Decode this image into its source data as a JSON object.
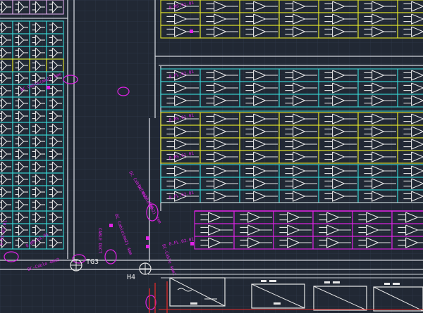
{
  "drawing": {
    "grid_color": "#2c3545",
    "colors": {
      "cyan": "#39d3d3",
      "yellow": "#e4e62c",
      "magenta": "#e022e6",
      "white": "#e8e8e8",
      "red": "#e02a2a",
      "background": "#212834"
    }
  },
  "labels": {
    "grounding_tag_1": "TG3",
    "grounding_tag_2": "H4",
    "row_codes": {
      "top_yellow": "0.MS.01.01",
      "mid_cyan_1": "0.FL.02.01",
      "mid_yellow_1": "0.FL.09.01",
      "mid_cyan_2": "0.FL.06.01",
      "magenta_row": "0.FL.02.01",
      "left_col_1": "0.MS.01.01",
      "left_col_2": "0.MS.01.01"
    },
    "annotations": {
      "dc_cable_a": "DC Cable(mm2) 4mm",
      "dc_cable_b": "DC Cable(mm2) 4mm",
      "dc_cable_c": "DC Cable(mm2) 4mm",
      "dc_label_d": "DC-Cable 4mm2",
      "conduit_1": "CABLE DUCT"
    }
  }
}
